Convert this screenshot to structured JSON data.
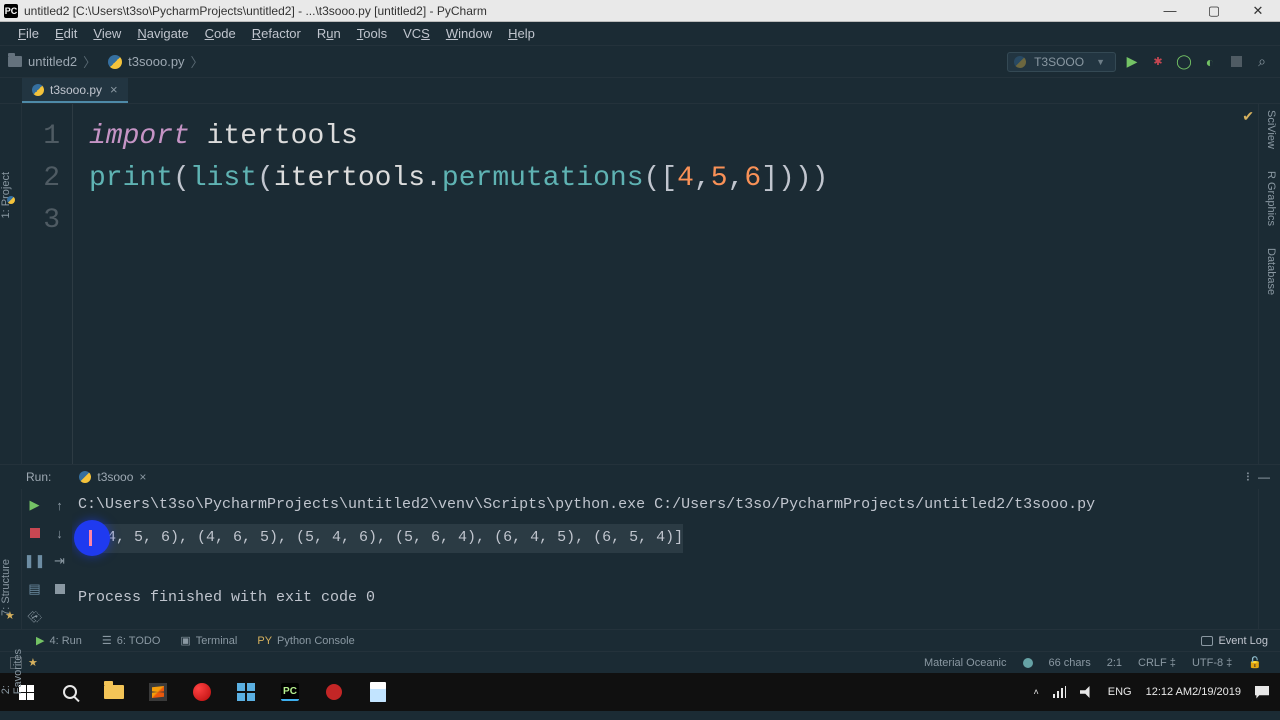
{
  "window": {
    "title": "untitled2 [C:\\Users\\t3so\\PycharmProjects\\untitled2] - ...\\t3sooo.py [untitled2] - PyCharm",
    "app_badge": "PC"
  },
  "menu": {
    "items": [
      "File",
      "Edit",
      "View",
      "Navigate",
      "Code",
      "Refactor",
      "Run",
      "Tools",
      "VCS",
      "Window",
      "Help"
    ]
  },
  "breadcrumb": {
    "project": "untitled2",
    "file": "t3sooo.py"
  },
  "run_config": {
    "name": "T3SOOO"
  },
  "editor_tab": {
    "file": "t3sooo.py"
  },
  "code": {
    "line_numbers": [
      "1",
      "2",
      "3"
    ],
    "l1_kw": "import",
    "l1_mod": " itertools",
    "l2_print": "print",
    "l2_list": "list",
    "l2_mod": "itertools",
    "l2_perm": "permutations",
    "l2_n1": "4",
    "l2_n2": "5",
    "l2_n3": "6"
  },
  "left_gutter": {
    "project_label": "1: Project",
    "structure_label": "7: Structure",
    "favorites_label": "2: Favorites"
  },
  "right_gutter": {
    "labels": [
      "SciView",
      "R Graphics",
      "Database"
    ]
  },
  "run_panel": {
    "label": "Run:",
    "tab": "t3sooo",
    "cmd": "C:\\Users\\t3so\\PycharmProjects\\untitled2\\venv\\Scripts\\python.exe C:/Users/t3so/PycharmProjects/untitled2/t3sooo.py",
    "output": "(4, 5, 6), (4, 6, 5), (5, 4, 6), (5, 6, 4), (6, 4, 5), (6, 5, 4)]",
    "exit": "Process finished with exit code 0"
  },
  "tool_tabs": {
    "run": "4: Run",
    "todo": "6: TODO",
    "terminal": "Terminal",
    "pyconsole": "Python Console",
    "event_log": "Event Log"
  },
  "status": {
    "theme": "Material Oceanic",
    "chars": "66 chars",
    "pos": "2:1",
    "sep": "CRLF",
    "enc": "UTF-8"
  },
  "taskbar": {
    "lang": "ENG",
    "time": "12:12 AM",
    "date": "2/19/2019"
  }
}
